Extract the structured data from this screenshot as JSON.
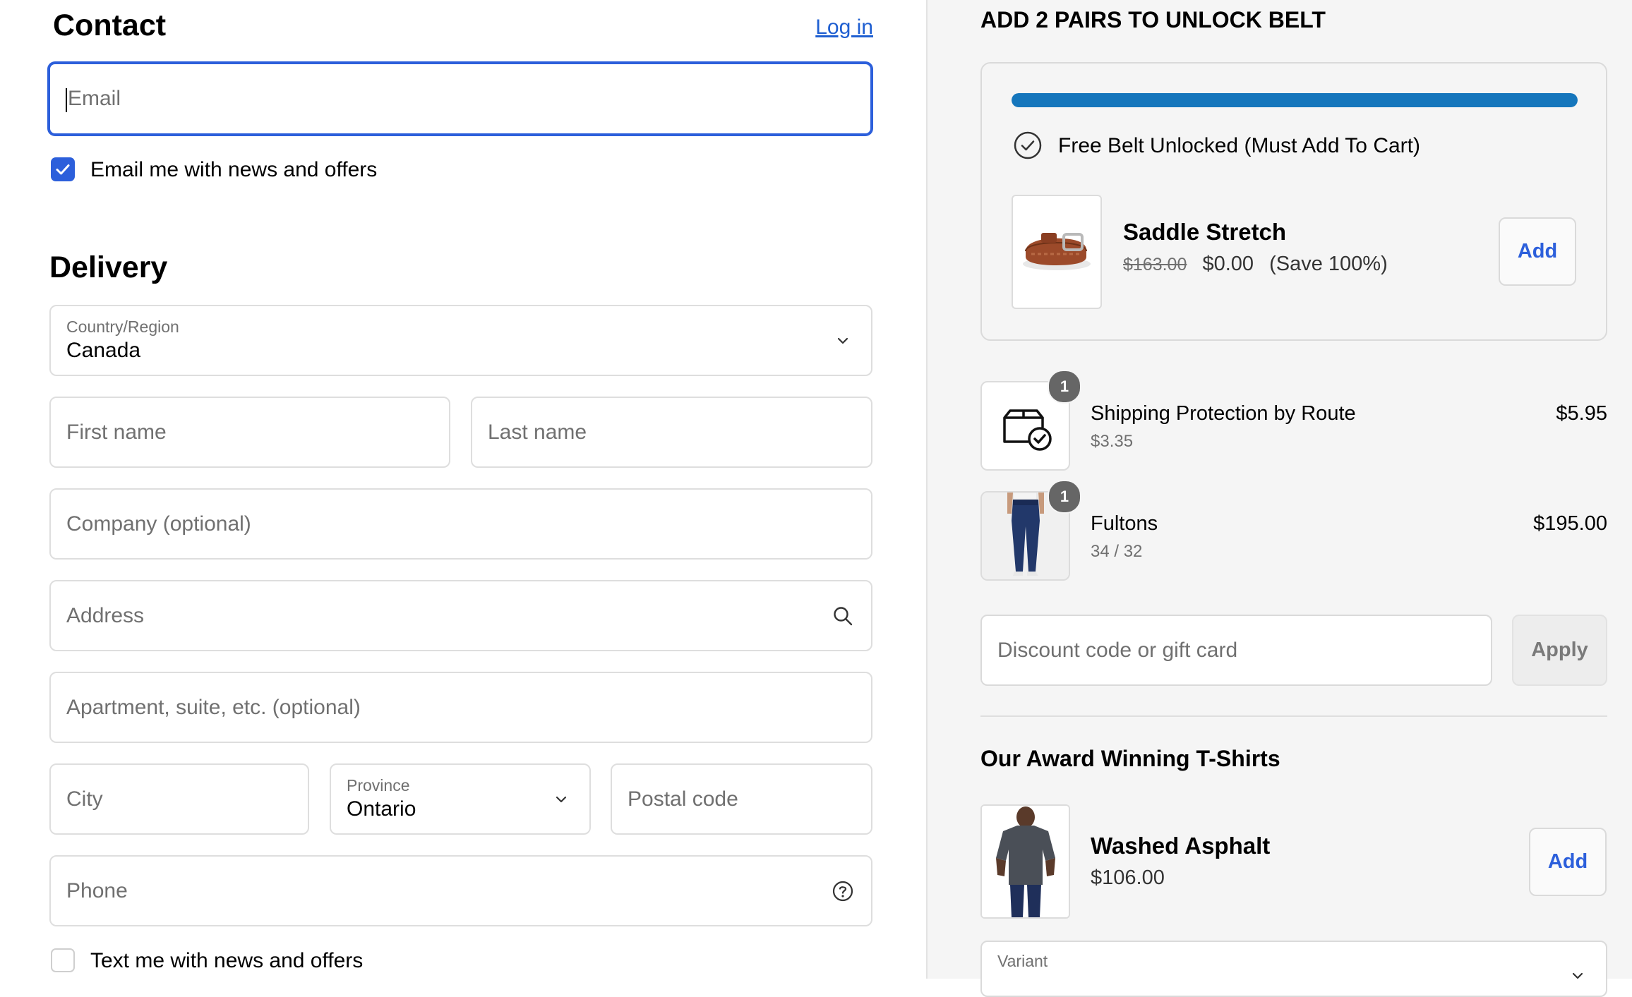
{
  "contact": {
    "title": "Contact",
    "login_link": "Log in",
    "email_placeholder": "Email",
    "newsletter_label": "Email me with news and offers",
    "newsletter_checked": true
  },
  "delivery": {
    "title": "Delivery",
    "country_label": "Country/Region",
    "country_value": "Canada",
    "first_name_placeholder": "First name",
    "last_name_placeholder": "Last name",
    "company_placeholder": "Company (optional)",
    "address_placeholder": "Address",
    "apartment_placeholder": "Apartment, suite, etc. (optional)",
    "city_placeholder": "City",
    "province_label": "Province",
    "province_value": "Ontario",
    "postal_placeholder": "Postal code",
    "phone_placeholder": "Phone",
    "sms_label": "Text me with news and offers",
    "sms_checked": false
  },
  "promo": {
    "title": "ADD 2 PAIRS TO UNLOCK BELT",
    "progress": 1.0,
    "progress_color": "#1576bc",
    "unlocked_text": "Free Belt Unlocked (Must Add To Cart)",
    "product": {
      "name": "Saddle Stretch",
      "original_price": "$163.00",
      "price": "$0.00",
      "savings": "(Save 100%)",
      "add_label": "Add"
    }
  },
  "cart": {
    "items": [
      {
        "name": "Shipping Protection by Route",
        "sub": "$3.35",
        "price": "$5.95",
        "qty": "1",
        "icon": "shipping-protection-icon"
      },
      {
        "name": "Fultons",
        "sub": "34 / 32",
        "price": "$195.00",
        "qty": "1",
        "icon": "jeans-image"
      }
    ]
  },
  "discount": {
    "placeholder": "Discount code or gift card",
    "apply_label": "Apply"
  },
  "upsell": {
    "title": "Our Award Winning T-Shirts",
    "product": {
      "name": "Washed Asphalt",
      "price": "$106.00",
      "add_label": "Add"
    },
    "variant_label": "Variant"
  },
  "colors": {
    "accent": "#2c5fdb",
    "link": "#1f5fd1"
  }
}
